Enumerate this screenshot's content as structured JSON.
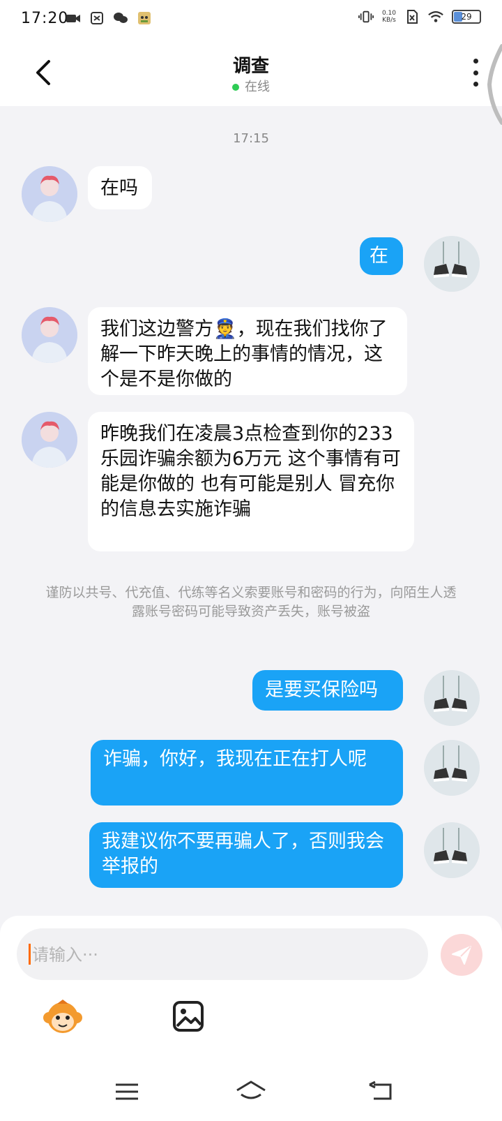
{
  "status_bar": {
    "time": "17:20",
    "net_speed_value": "0.10",
    "net_speed_unit": "KB/s",
    "battery": "29"
  },
  "header": {
    "title": "调查",
    "status": "在线"
  },
  "chat": {
    "timestamp": "17:15",
    "messages": [
      {
        "side": "in",
        "text": "在吗"
      },
      {
        "side": "out",
        "text": "在"
      },
      {
        "side": "in",
        "text": "我们这边警方👮，现在我们找你了解一下昨天晚上的事情的情况，这个是不是你做的"
      },
      {
        "side": "in",
        "text": "昨晚我们在凌晨3点检查到你的233乐园诈骗余额为6万元 这个事情有可能是你做的 也有可能是别人 冒充你的信息去实施诈骗"
      },
      {
        "side": "out",
        "text": "是要买保险吗"
      },
      {
        "side": "out",
        "text": "诈骗，你好，我现在正在打人呢"
      },
      {
        "side": "out",
        "text": "我建议你不要再骗人了，否则我会举报的"
      }
    ],
    "notice": "谨防以共号、代充值、代练等名义索要账号和密码的行为，向陌生人透露账号密码可能导致资产丢失，账号被盗"
  },
  "composer": {
    "placeholder": "请输入···"
  },
  "colors": {
    "outgoing_bubble": "#1aa3f6",
    "incoming_bubble": "#ffffff",
    "online_dot": "#2ecc55",
    "send_button": "#fbd8d8"
  },
  "icons": {
    "back": "chevron-left-icon",
    "more": "more-vertical-icon",
    "send": "send-icon",
    "emoji": "monkey-emoji-icon",
    "image": "image-icon",
    "nav_menu": "menu-icon",
    "nav_home": "home-icon",
    "nav_back": "back-arrow-icon"
  }
}
